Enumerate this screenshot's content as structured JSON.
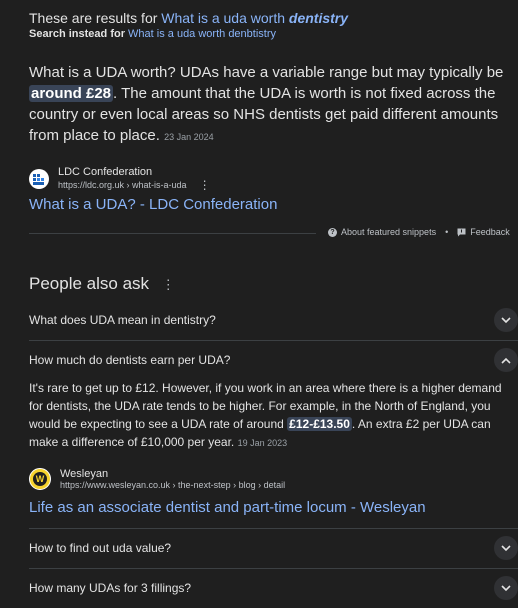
{
  "correction": {
    "prefix": "These are results for",
    "query_plain": "What is a uda worth",
    "query_emphasis": "dentistry",
    "search_instead_label": "Search instead for",
    "original_query": "What is a uda worth denbtistry"
  },
  "snippet": {
    "text_before": "What is a UDA worth? UDAs have a variable range but may typically be ",
    "highlight": "around £28",
    "text_after": ". The amount that the UDA is worth is not fixed across the country or even local areas so NHS dentists get paid different amounts from place to place.",
    "date": "23 Jan 2024",
    "source_name": "LDC Confederation",
    "source_url": "https://ldc.org.uk › what-is-a-uda",
    "link_title": "What is a UDA? - LDC Confederation"
  },
  "snippet_footer": {
    "about": "About featured snippets",
    "separator": "•",
    "feedback": "Feedback"
  },
  "paa": {
    "title": "People also ask",
    "questions": [
      "What does UDA mean in dentistry?",
      "How much do dentists earn per UDA?",
      "How to find out uda value?",
      "How many UDAs for 3 fillings?"
    ],
    "expanded_answer": {
      "text_before": "It's rare to get up to £12. However, if you work in an area where there is a higher demand for dentists, the UDA rate tends to be higher. For example, in the North of England, you would be expecting to see a UDA rate of around ",
      "highlight": "£12-£13.50",
      "text_after": ". An extra £2 per UDA can make a difference of £10,000 per year.",
      "date": "19 Jan 2023",
      "source_name": "Wesleyan",
      "source_url": "https://www.wesleyan.co.uk › the-next-step › blog › detail",
      "link_title": "Life as an associate dentist and part-time locum - Wesleyan"
    }
  },
  "colors": {
    "background": "#1f1f1f",
    "link": "#8ab4f8",
    "highlight_bg": "#394457",
    "divider": "#3c4043"
  },
  "icons": [
    "ldc-favicon-icon",
    "more-options-icon",
    "question-circle-icon",
    "feedback-icon",
    "chevron-down-icon",
    "chevron-up-icon",
    "wesleyan-favicon-icon"
  ]
}
